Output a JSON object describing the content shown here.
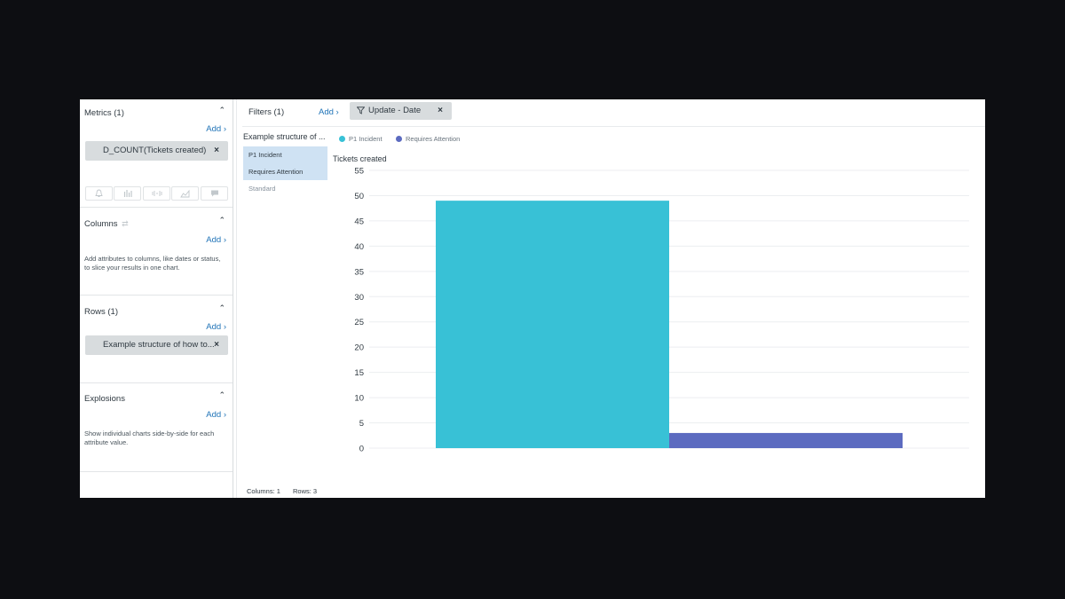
{
  "left_panel": {
    "metrics": {
      "title": "Metrics (1)",
      "add": "Add ›",
      "pill": "D_COUNT(Tickets created)"
    },
    "viz_icons": [
      "bell-icon",
      "bar-chart-icon",
      "signal-icon",
      "area-chart-icon",
      "comment-icon"
    ],
    "columns": {
      "title": "Columns",
      "add": "Add ›",
      "hint": "Add attributes to columns, like dates or status, to slice your results in one chart."
    },
    "rows": {
      "title": "Rows (1)",
      "add": "Add ›",
      "pill": "Example structure of how to..."
    },
    "explosions": {
      "title": "Explosions",
      "add": "Add ›",
      "hint": "Show individual charts side-by-side for each attribute value."
    },
    "collapse_glyph": "⌃",
    "remove_glyph": "×"
  },
  "filters": {
    "label": "Filters (1)",
    "add": "Add ›",
    "chip": "Update - Date",
    "remove": "×"
  },
  "row_list": {
    "header": "Example structure of ...",
    "items": [
      {
        "label": "P1 Incident",
        "selected": true
      },
      {
        "label": "Requires Attention",
        "selected": true
      },
      {
        "label": "Standard",
        "selected": false
      }
    ]
  },
  "legend": [
    {
      "label": "P1 Incident",
      "color": "#38c1d6"
    },
    {
      "label": "Requires Attention",
      "color": "#5c6bc0"
    }
  ],
  "footer": {
    "columns": "Columns: 1",
    "rows": "Rows: 3"
  },
  "chart_data": {
    "type": "bar",
    "ylabel": "Tickets created",
    "ylim": [
      0,
      55
    ],
    "yticks": [
      0,
      5,
      10,
      15,
      20,
      25,
      30,
      35,
      40,
      45,
      50,
      55
    ],
    "grid": true,
    "series": [
      {
        "name": "P1 Incident",
        "value": 49,
        "color": "#38c1d6"
      },
      {
        "name": "Requires Attention",
        "value": 3,
        "color": "#5c6bc0"
      }
    ]
  }
}
